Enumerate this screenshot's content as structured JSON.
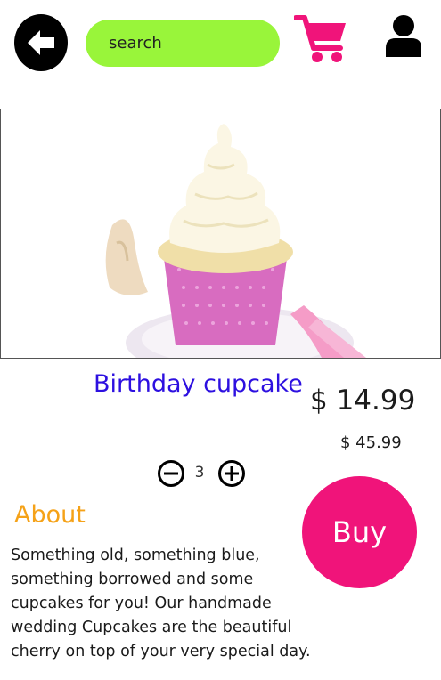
{
  "header": {
    "back_icon": "arrow-left-icon",
    "search_placeholder": "search",
    "search_value": "",
    "cart_icon": "shopping-cart-icon",
    "profile_icon": "user-icon",
    "search_color": "#99f53a",
    "cart_color": "#f0147a"
  },
  "product": {
    "image_alt": "cupcake",
    "title": "Birthday cupcake",
    "price": "$ 14.99",
    "total": "$ 45.99",
    "title_color": "#2d10e0"
  },
  "quantity": {
    "value": "3",
    "minus_icon": "minus-circle-icon",
    "plus_icon": "plus-circle-icon"
  },
  "about": {
    "heading": "About",
    "text": "Something old, something blue,\n something borrowed and some\n cupcakes for you! Our handmade\n wedding Cupcakes are the beautiful\ncherry on top of your very special day.",
    "heading_color": "#f5a218"
  },
  "buy": {
    "label": "Buy",
    "color": "#f0147a"
  }
}
